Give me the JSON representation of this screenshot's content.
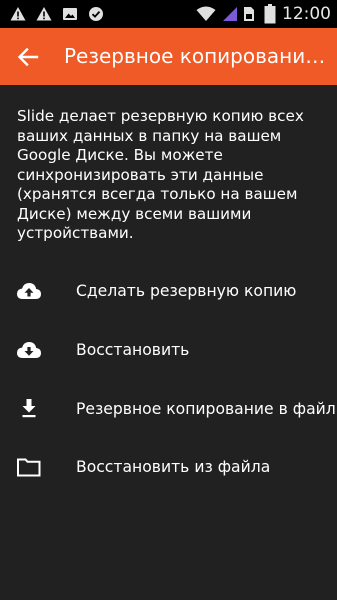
{
  "status_bar": {
    "time": "12:00",
    "icons": [
      "warning-icon",
      "warning-icon",
      "image-icon",
      "check-shield-icon",
      "wifi-icon",
      "signal-icon",
      "sim-icon",
      "battery-icon"
    ]
  },
  "toolbar": {
    "back_icon": "arrow-back-icon",
    "title": "Резервное копирование...",
    "color": "#ef5a26"
  },
  "description": "Slide делает резервную копию всех ваших данных в папку на вашем Google Диске. Вы можете синхронизировать эти данные (хранятся всегда только на вашем Диске) между всеми вашими устройствами.",
  "actions": [
    {
      "icon": "cloud-upload-icon",
      "label": "Сделать резервную копию"
    },
    {
      "icon": "cloud-download-icon",
      "label": "Восстановить"
    },
    {
      "icon": "download-icon",
      "label": "Резервное копирование в файл"
    },
    {
      "icon": "folder-icon",
      "label": "Восстановить из файла"
    }
  ]
}
